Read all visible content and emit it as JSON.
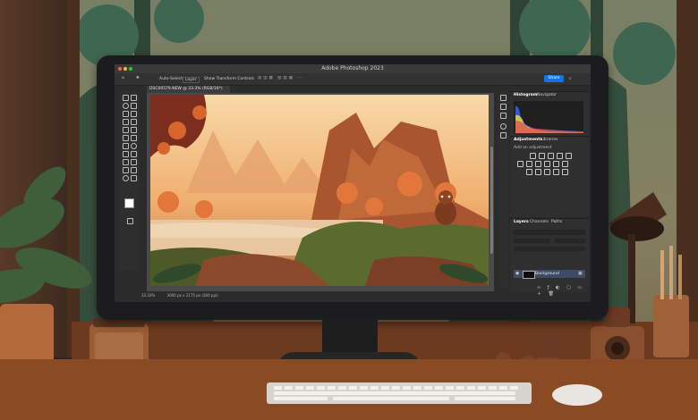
{
  "photoshop": {
    "app_title": "Adobe Photoshop 2023",
    "options_bar": {
      "auto_select": "Auto-Select:",
      "layer_select": "Layer",
      "show_transform": "Show Transform Controls",
      "share": "Share"
    },
    "document_tab": "DSC00579.NEW @ 33.3% (RGB/16*)",
    "status_zoom": "33.33%",
    "status_info": "3000 px x 2175 px (300 ppi)",
    "panels": {
      "histogram_tabs": [
        "Histogram",
        "Navigator"
      ],
      "adjustments_tabs": [
        "Adjustments",
        "Libraries"
      ],
      "adjustments_hint": "Add an adjustment",
      "layers_tabs": [
        "Layers",
        "Channels",
        "Paths"
      ],
      "layer_name": "Background"
    }
  },
  "colors": {
    "accent": "#1473e6",
    "desk": "#8a4a23",
    "sunset": "#f0b070"
  }
}
